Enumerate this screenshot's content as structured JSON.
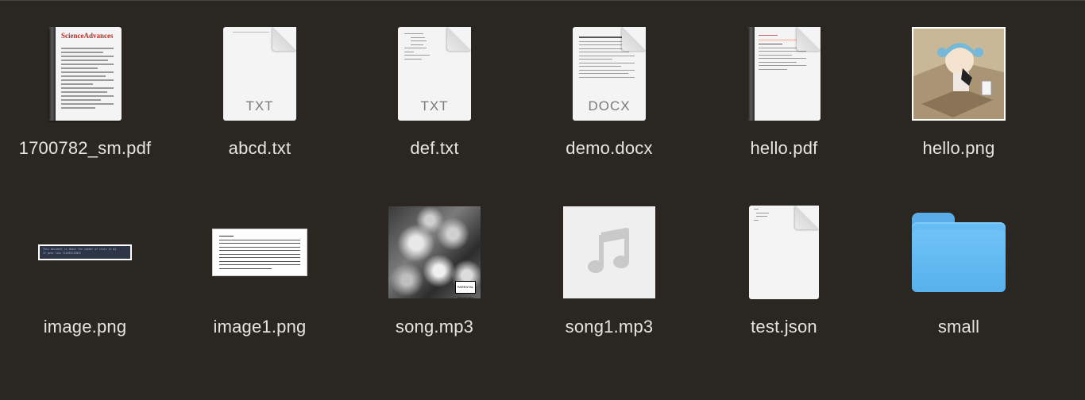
{
  "window": {
    "background": "#2a2723"
  },
  "files": [
    {
      "name": "1700782_sm.pdf",
      "kind": "pdf",
      "icon": "pdf-document-icon",
      "header_text": "ScienceAdvances"
    },
    {
      "name": "abcd.txt",
      "kind": "txt",
      "icon": "text-document-icon",
      "ext": "TXT"
    },
    {
      "name": "def.txt",
      "kind": "txt",
      "icon": "text-document-icon",
      "ext": "TXT"
    },
    {
      "name": "demo.docx",
      "kind": "docx",
      "icon": "word-document-icon",
      "ext": "DOCX"
    },
    {
      "name": "hello.pdf",
      "kind": "pdf",
      "icon": "pdf-document-icon"
    },
    {
      "name": "hello.png",
      "kind": "png",
      "icon": "image-thumbnail-icon"
    },
    {
      "name": "image.png",
      "kind": "png",
      "icon": "image-thumbnail-icon",
      "preview_text": "This document is about the number of stars in m4.\nIt goes like ILOVESCIENCE"
    },
    {
      "name": "image1.png",
      "kind": "png",
      "icon": "image-thumbnail-icon"
    },
    {
      "name": "song.mp3",
      "kind": "mp3",
      "icon": "album-art-icon",
      "badge": "PARENTAL ADVISORY"
    },
    {
      "name": "song1.mp3",
      "kind": "mp3",
      "icon": "music-note-icon"
    },
    {
      "name": "test.json",
      "kind": "json",
      "icon": "json-document-icon"
    },
    {
      "name": "small",
      "kind": "folder",
      "icon": "folder-icon"
    }
  ],
  "colors": {
    "folder": "#66bdf5",
    "label": "#e6e4e1"
  }
}
